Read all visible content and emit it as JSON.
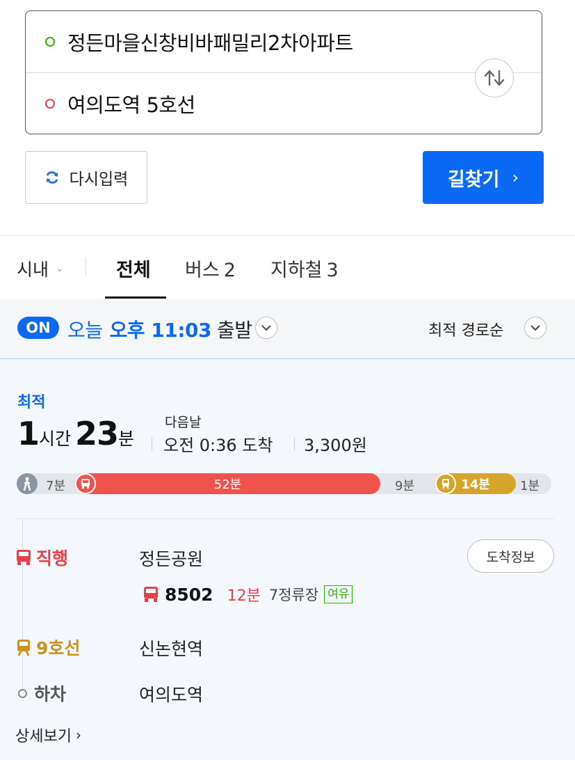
{
  "search": {
    "origin": "정든마을신창비바패밀리2차아파트",
    "destination": "여의도역 5호선",
    "swap_icon": "swap-updown-icon"
  },
  "actions": {
    "reset_label": "다시입력",
    "go_label": "길찾기"
  },
  "filter": {
    "region": "시내",
    "tabs": [
      {
        "label": "전체",
        "count": "",
        "active": true
      },
      {
        "label": "버스",
        "count": "2",
        "active": false
      },
      {
        "label": "지하철",
        "count": "3",
        "active": false
      }
    ]
  },
  "departure": {
    "toggle": "ON",
    "day": "오늘",
    "time": "오후 11:03",
    "suffix": "출발",
    "sort": "최적 경로순"
  },
  "route": {
    "badge": "최적",
    "hours": "1",
    "hours_unit": "시간",
    "minutes": "23",
    "minutes_unit": "분",
    "next_day": "다음날",
    "arrival": "오전 0:36 도착",
    "fare": "3,300원",
    "timeline": {
      "walk": "7분",
      "bus": "52분",
      "wait": "9분",
      "subway": "14분",
      "end": "1분"
    },
    "steps": [
      {
        "mode": "직행",
        "place": "정든공원",
        "color": "#e8404a"
      },
      {
        "mode": "9호선",
        "place": "신논현역",
        "color": "#c9951e"
      },
      {
        "mode": "하차",
        "place": "여의도역",
        "color": "#555555"
      }
    ],
    "arrival_info_btn": "도착정보",
    "bus": {
      "number": "8502",
      "eta": "12분",
      "stops": "7정류장",
      "crowd": "여유"
    },
    "detail_link": "상세보기"
  },
  "colors": {
    "accent": "#0a6af3",
    "bus_red": "#f0524c",
    "subway_line9": "#d4a52a",
    "crowd_green": "#2db400"
  }
}
